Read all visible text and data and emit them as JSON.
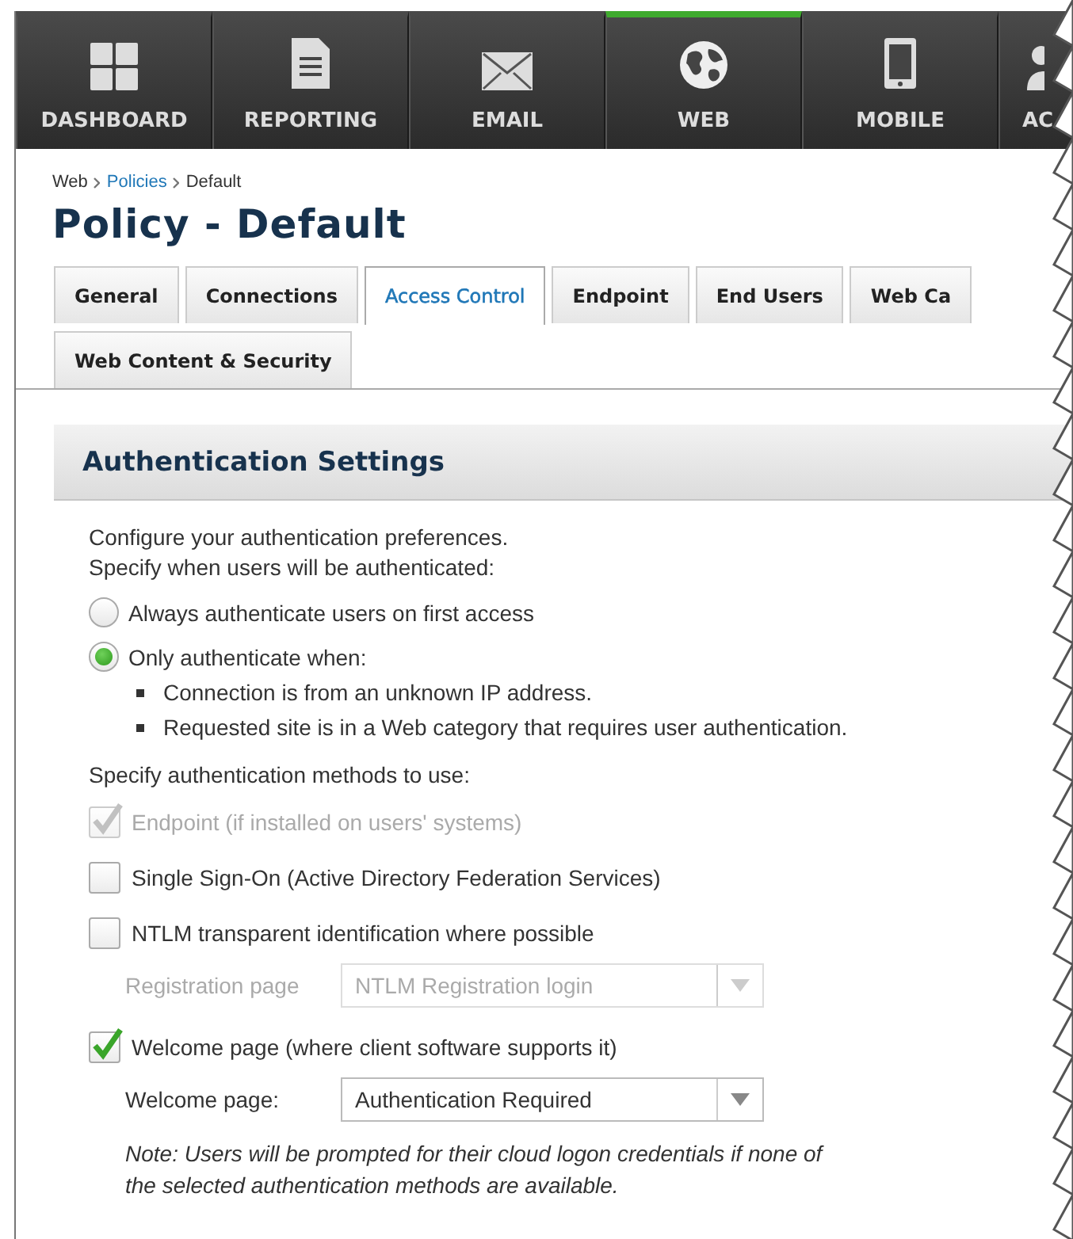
{
  "nav": [
    {
      "label": "DASHBOARD",
      "selected": false
    },
    {
      "label": "REPORTING",
      "selected": false
    },
    {
      "label": "EMAIL",
      "selected": false
    },
    {
      "label": "WEB",
      "selected": true
    },
    {
      "label": "MOBILE",
      "selected": false
    },
    {
      "label": "AC",
      "selected": false
    }
  ],
  "breadcrumb": [
    {
      "label": "Web",
      "link": false
    },
    {
      "label": "Policies",
      "link": true
    },
    {
      "label": "Default",
      "link": false
    }
  ],
  "title": "Policy - Default",
  "tabs": [
    {
      "label": "General",
      "selected": false
    },
    {
      "label": "Connections",
      "selected": false
    },
    {
      "label": "Access Control",
      "selected": true
    },
    {
      "label": "Endpoint",
      "selected": false
    },
    {
      "label": "End Users",
      "selected": false
    },
    {
      "label": "Web Ca",
      "selected": false
    },
    {
      "label": "Web Content & Security",
      "selected": false
    }
  ],
  "section": {
    "title": "Authentication Settings",
    "intro": [
      "Configure your authentication preferences.",
      "Specify when users will be authenticated:"
    ],
    "when_options": [
      {
        "label": "Always authenticate users on first access",
        "selected": false
      },
      {
        "label": "Only authenticate when:",
        "selected": true,
        "conditions": [
          "Connection is from an unknown IP address.",
          "Requested site is in a Web category that requires user authentication."
        ]
      }
    ],
    "methods_heading": "Specify authentication methods to use:",
    "methods": [
      {
        "label": "Endpoint (if installed on users' systems)",
        "checked": true,
        "disabled": true
      },
      {
        "label": "Single Sign-On (Active Directory Federation Services)",
        "checked": false,
        "disabled": false
      },
      {
        "label": "NTLM transparent identification where possible",
        "checked": false,
        "disabled": false,
        "select": {
          "label": "Registration page",
          "value": "NTLM Registration login",
          "disabled": true
        }
      },
      {
        "label": "Welcome page (where client software supports it)",
        "checked": true,
        "disabled": false,
        "select": {
          "label": "Welcome page:",
          "value": "Authentication Required",
          "disabled": false
        }
      }
    ],
    "note": "Note: Users will be prompted for their cloud logon credentials if none of the selected authentication methods are available."
  }
}
